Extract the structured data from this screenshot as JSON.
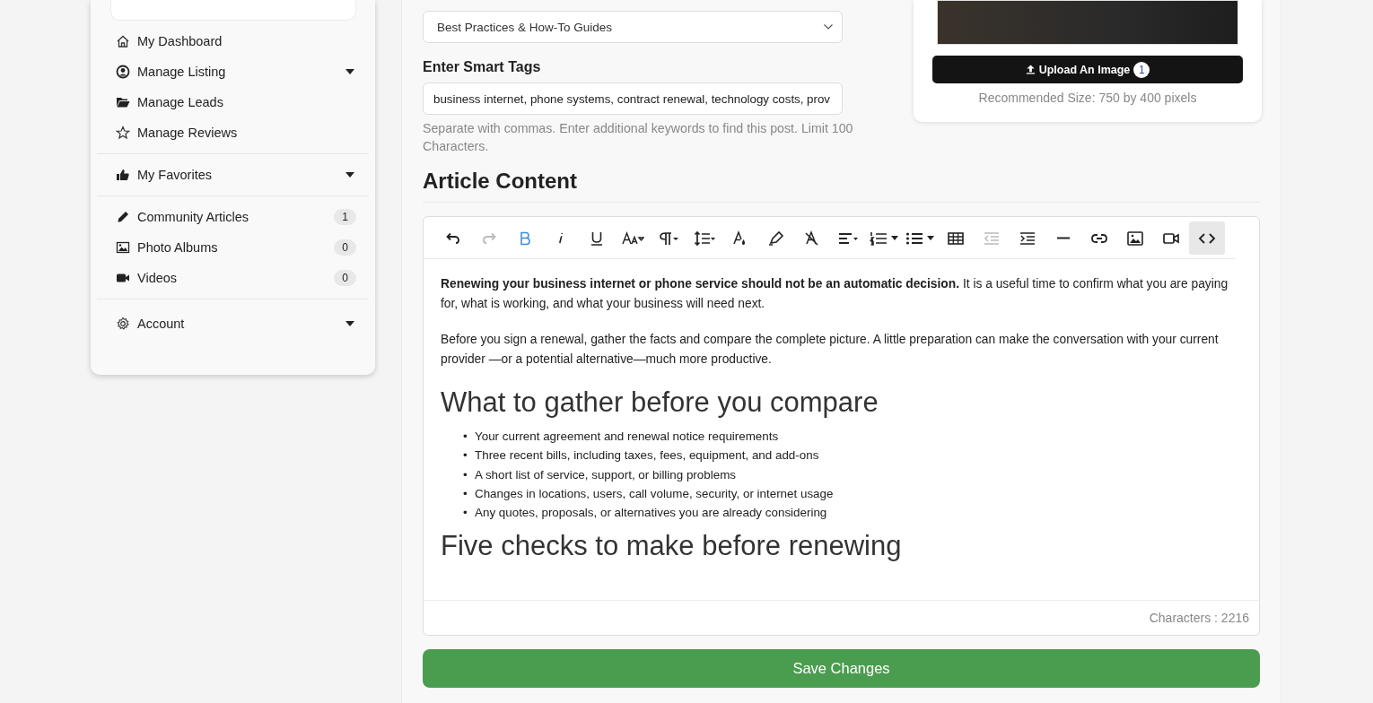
{
  "sidebar": {
    "groups": [
      [
        {
          "label": "My Dashboard",
          "dropdown": false
        },
        {
          "label": "Manage Listing",
          "dropdown": true
        },
        {
          "label": "Manage Leads",
          "dropdown": false
        },
        {
          "label": "Manage Reviews",
          "dropdown": false
        }
      ],
      [
        {
          "label": "My Favorites",
          "dropdown": true
        }
      ],
      [
        {
          "label": "Community Articles",
          "dropdown": false,
          "count": "1"
        },
        {
          "label": "Photo Albums",
          "dropdown": false,
          "count": "0"
        },
        {
          "label": "Videos",
          "dropdown": false,
          "count": "0"
        }
      ],
      [
        {
          "label": "Account",
          "dropdown": true
        }
      ]
    ]
  },
  "form": {
    "category": {
      "value": "Best Practices & How-To Guides"
    },
    "tags": {
      "label": "Enter Smart Tags",
      "value": "business internet, phone systems, contract renewal, technology costs, prov",
      "help": "Separate with commas. Enter additional keywords to find this post. Limit 100 Characters."
    }
  },
  "image_card": {
    "upload_button": "Upload An Image",
    "upload_count": "1",
    "hint": "Recommended Size: 750 by 400 pixels"
  },
  "article": {
    "heading": "Article Content",
    "toolbar": [
      {
        "kind": "undo",
        "active": false,
        "disabled": false
      },
      {
        "kind": "redo",
        "active": false,
        "disabled": true
      },
      {
        "kind": "bold",
        "active": true,
        "disabled": false
      },
      {
        "kind": "italic",
        "active": false,
        "disabled": false
      },
      {
        "kind": "underline",
        "active": false,
        "disabled": false
      },
      {
        "kind": "fontsize",
        "active": false,
        "disabled": false
      },
      {
        "kind": "paragraph",
        "active": false,
        "disabled": false
      },
      {
        "kind": "lineheight",
        "active": false,
        "disabled": false
      },
      {
        "kind": "textcolor",
        "active": false,
        "disabled": false
      },
      {
        "kind": "highlight",
        "active": false,
        "disabled": false
      },
      {
        "kind": "clearformat",
        "active": false,
        "disabled": false
      },
      {
        "kind": "align",
        "active": false,
        "disabled": false
      },
      {
        "kind": "orderedlist",
        "active": false,
        "disabled": false
      },
      {
        "kind": "bulletlist",
        "active": false,
        "disabled": false
      },
      {
        "kind": "table",
        "active": false,
        "disabled": false
      },
      {
        "kind": "outdent",
        "active": false,
        "disabled": true
      },
      {
        "kind": "indent",
        "active": false,
        "disabled": false
      },
      {
        "kind": "rule",
        "active": false,
        "disabled": false
      },
      {
        "kind": "link",
        "active": false,
        "disabled": false
      },
      {
        "kind": "image",
        "active": false,
        "disabled": false
      },
      {
        "kind": "video",
        "active": false,
        "disabled": false
      },
      {
        "kind": "code",
        "active": true,
        "disabled": false
      }
    ],
    "blocks": [
      {
        "kind": "paragraph",
        "text": "**Renewing your business internet or phone service should not be an automatic decision.** It is a useful time to confirm what you are paying for, what is working, and what your business will need next."
      },
      {
        "kind": "paragraph",
        "text": "Before you sign a renewal, gather the facts and compare the complete picture. A little preparation can make the conversation with your current provider —or a potential alternative—much more productive."
      },
      {
        "kind": "heading",
        "text": "What to gather before you compare"
      },
      {
        "kind": "list",
        "marker": "•",
        "items": [
          "Your current agreement and renewal notice requirements",
          "Three recent bills, including taxes, fees, equipment, and add-ons",
          "A short list of service, support, or billing problems",
          "Changes in locations, users, call volume, security, or internet usage",
          "Any quotes, proposals, or alternatives you are already considering"
        ]
      },
      {
        "kind": "heading",
        "text": "Five checks to make before renewing"
      }
    ],
    "char_count": "Characters : 2216"
  },
  "save_button": "Save Changes"
}
